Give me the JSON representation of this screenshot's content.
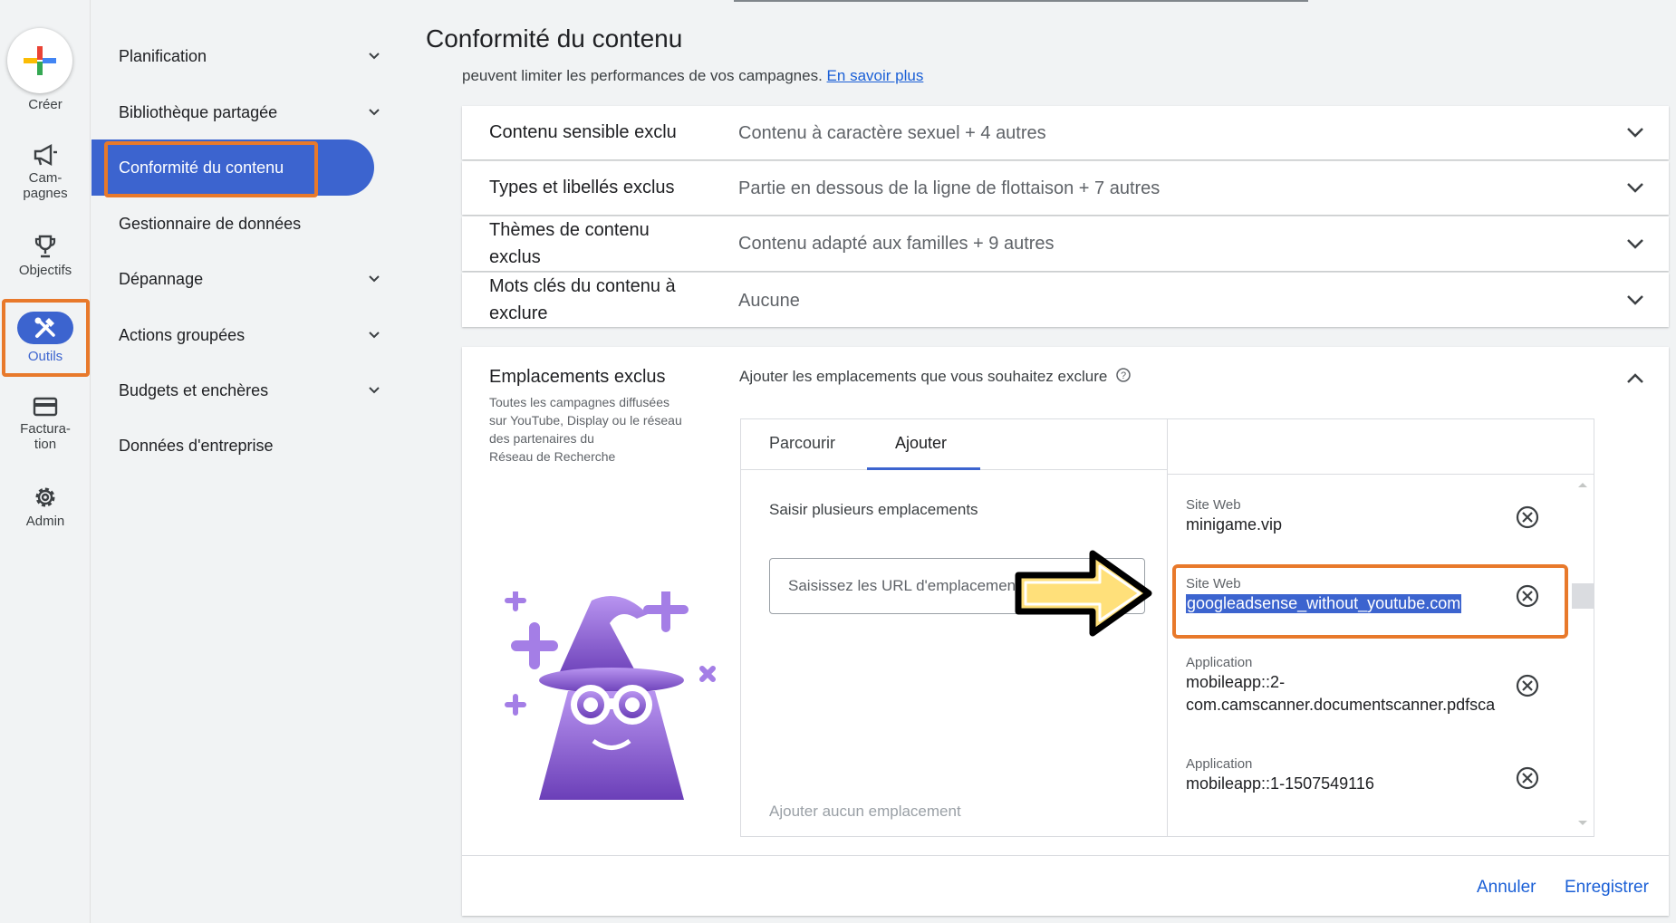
{
  "rail": {
    "create_label": "Créer",
    "campaigns_label_1": "Cam-",
    "campaigns_label_2": "pagnes",
    "goals_label": "Objectifs",
    "tools_label": "Outils",
    "billing_label_1": "Factura-",
    "billing_label_2": "tion",
    "admin_label": "Admin"
  },
  "nav": {
    "items": [
      {
        "label": "Planification"
      },
      {
        "label": "Bibliothèque partagée"
      },
      {
        "label": "Conformité du contenu"
      },
      {
        "label": "Gestionnaire de données"
      },
      {
        "label": "Dépannage"
      },
      {
        "label": "Actions groupées"
      },
      {
        "label": "Budgets et enchères"
      },
      {
        "label": "Données d'entreprise"
      }
    ]
  },
  "page": {
    "title": "Conformité du contenu",
    "subtitle": "peuvent limiter les performances de vos campagnes.",
    "learn_more": "En savoir plus"
  },
  "rows": [
    {
      "label": "Contenu sensible exclu",
      "value": "Contenu à caractère sexuel + 4 autres"
    },
    {
      "label": "Types et libellés exclus",
      "value": "Partie en dessous de la ligne de flottaison + 7 autres"
    },
    {
      "label_1": "Thèmes de contenu",
      "label_2": "exclus",
      "value": "Contenu adapté aux familles + 9 autres"
    },
    {
      "label_1": "Mots clés du contenu à",
      "label_2": "exclure",
      "value": "Aucune"
    }
  ],
  "placements": {
    "title": "Emplacements exclus",
    "description": [
      "Toutes les campagnes diffusées",
      "sur YouTube, Display ou le réseau",
      "des partenaires du",
      "Réseau de Recherche"
    ],
    "hint": "Ajouter les emplacements que vous souhaitez exclure",
    "tabs": [
      "Parcourir",
      "Ajouter"
    ],
    "enter_label": "Saisir plusieurs emplacements",
    "input_placeholder": "Saisissez les URL d'emplacements",
    "empty_label": "Ajouter aucun emplacement",
    "entries": [
      {
        "type": "Site Web",
        "value": "minigame.vip"
      },
      {
        "type": "Site Web",
        "value": "googleadsense_without_youtube.com"
      },
      {
        "type": "Application",
        "value_1": "mobileapp::2-",
        "value_2": "com.camscanner.documentscanner.pdfsca"
      },
      {
        "type": "Application",
        "value": "mobileapp::1-1507549116"
      }
    ]
  },
  "footer": {
    "cancel": "Annuler",
    "save": "Enregistrer"
  },
  "colors": {
    "accent": "#3c64cf",
    "highlight": "#e8792b",
    "arrow": "#ffe07a",
    "wizard": "#8a63d2"
  }
}
